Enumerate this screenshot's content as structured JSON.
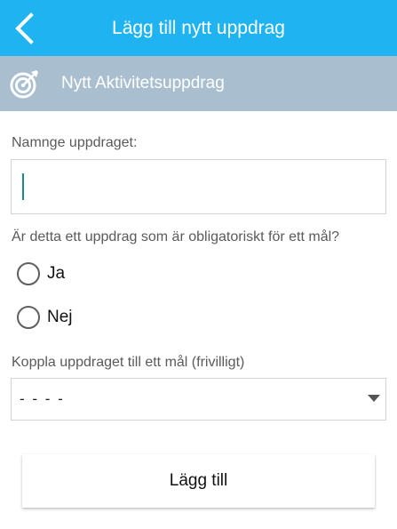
{
  "app_bar": {
    "title": "Lägg till nytt uppdrag",
    "back_icon": "chevron-left-icon",
    "color": "#1fb4f1"
  },
  "section_header": {
    "title": "Nytt Aktivitetsuppdrag",
    "icon": "target-icon",
    "color": "#a9bfcf"
  },
  "form": {
    "name_label": "Namnge uppdraget:",
    "name_value": "",
    "mandatory_question": "Är detta ett uppdrag som är obligatoriskt för ett mål?",
    "options": [
      {
        "label": "Ja",
        "selected": false
      },
      {
        "label": "Nej",
        "selected": false
      }
    ],
    "goal_label": "Koppla uppdraget till ett mål (frivilligt)",
    "goal_selected": "- - - -",
    "submit_label": "Lägg till"
  }
}
